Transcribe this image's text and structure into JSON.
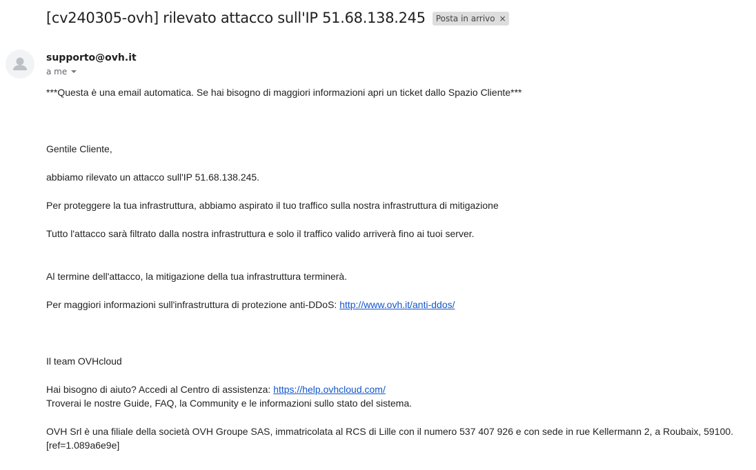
{
  "email": {
    "subject": "[cv240305-ovh] rilevato attacco sull'IP 51.68.138.245",
    "label": "Posta in arrivo",
    "label_close": "×",
    "sender": "supporto@ovh.it",
    "recipient": "a me",
    "avatar_icon": "person-icon",
    "body": {
      "automated_notice": "***Questa è una email automatica. Se hai bisogno di maggiori informazioni apri un ticket dallo Spazio Cliente***",
      "greeting": "Gentile Cliente,",
      "line_detected": "abbiamo rilevato un attacco sull'IP 51.68.138.245.",
      "line_protect": "Per proteggere la tua infrastruttura, abbiamo aspirato il tuo traffico sulla nostra infrastruttura di mitigazione",
      "line_filtered": "Tutto l'attacco sarà filtrato dalla nostra infrastruttura e solo il traffico valido arriverà fino ai tuoi server.",
      "line_end": "Al termine dell'attacco, la mitigazione della tua infrastruttura terminerà.",
      "line_info_prefix": "Per maggiori informazioni sull'infrastruttura di protezione anti-DDoS: ",
      "link_ddos": "http://www.ovh.it/anti-ddos/",
      "signature": "Il team OVHcloud",
      "help_prefix": "Hai bisogno di aiuto? Accedi al Centro di assistenza: ",
      "link_help": "https://help.ovhcloud.com/",
      "help_line2": "Troverai le nostre Guide, FAQ, la Community e le informazioni sullo stato del sistema.",
      "legal": "OVH Srl è una filiale della società OVH Groupe SAS, immatricolata al RCS di Lille con il numero 537 407 926 e con sede in rue Kellermann 2, a Roubaix, 59100.",
      "ref": "[ref=1.089a6e9e]"
    }
  },
  "colors": {
    "link": "#1155cc",
    "chip_bg": "#dddddd",
    "avatar_bg": "#f1f3f4"
  }
}
